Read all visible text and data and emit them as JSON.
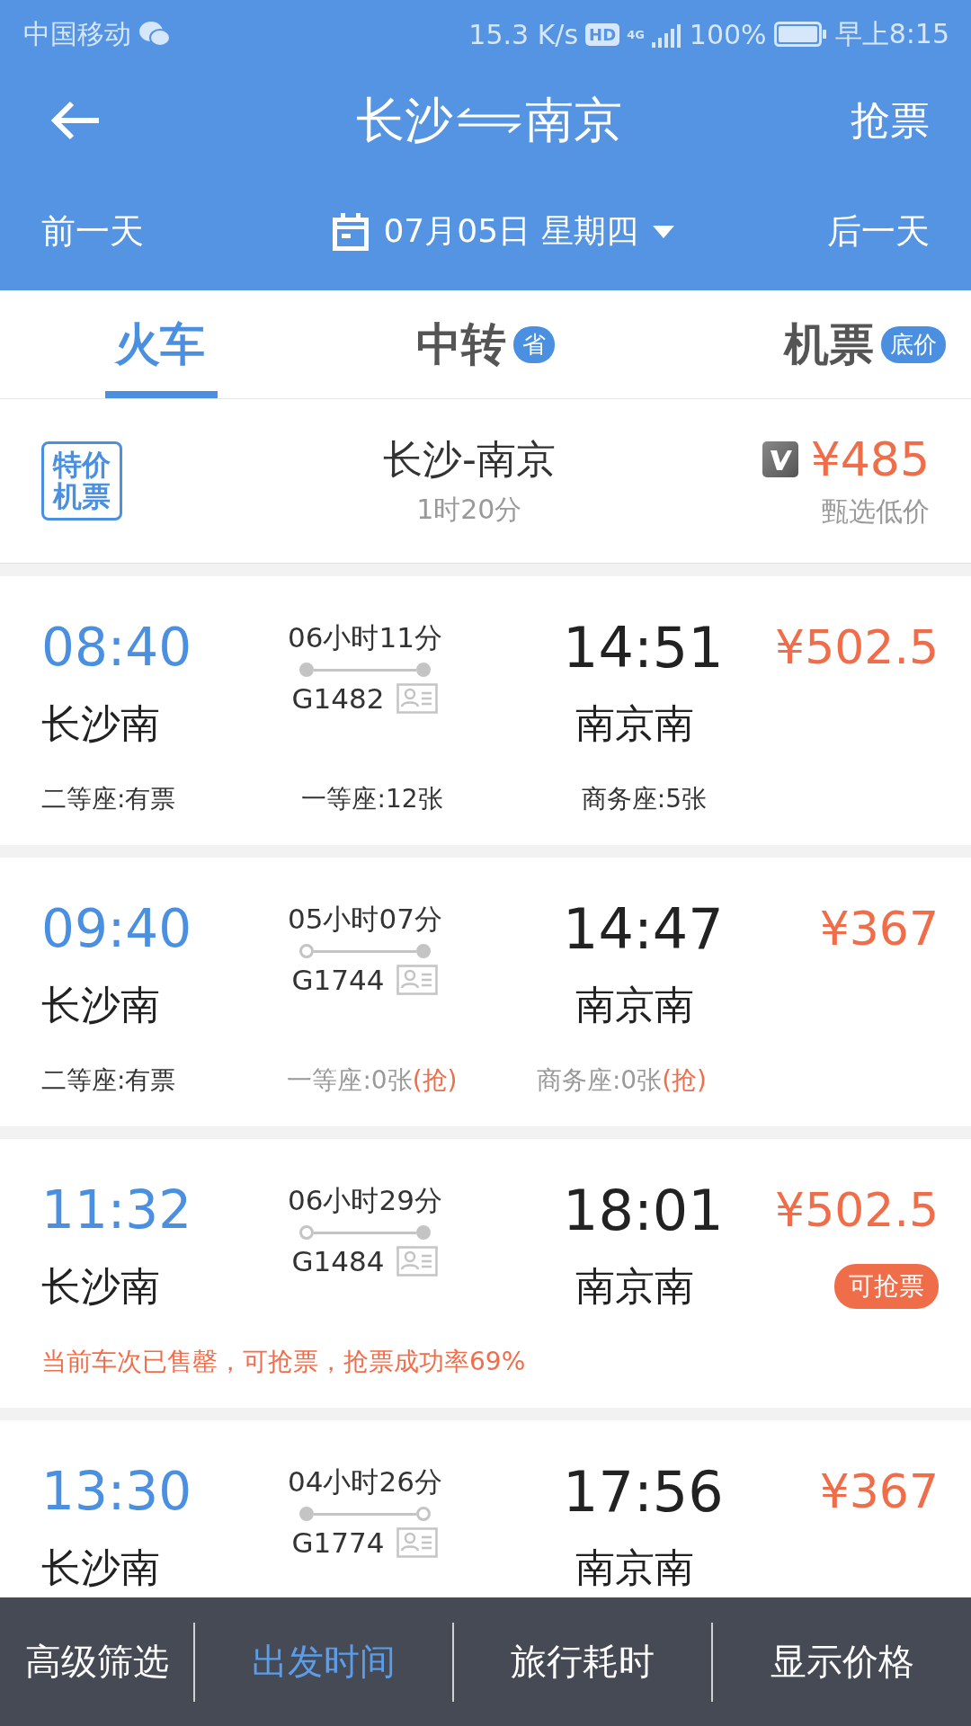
{
  "status_bar": {
    "carrier": "中国移动",
    "speed": "15.3 K/s",
    "hd": "HD",
    "network": "4G",
    "battery": "100%",
    "time": "早上8:15"
  },
  "header": {
    "from": "长沙",
    "to": "南京",
    "action": "抢票",
    "prev_day": "前一天",
    "date": "07月05日 星期四",
    "next_day": "后一天"
  },
  "tabs": [
    {
      "label": "火车",
      "selected": true
    },
    {
      "label": "中转",
      "badge": "省",
      "selected": false
    },
    {
      "label": "机票",
      "badge": "底价",
      "selected": false
    }
  ],
  "flight_promo": {
    "tag": "特价机票",
    "route": "长沙-南京",
    "duration": "1时20分",
    "price": "¥485",
    "price_note": "甄选低价"
  },
  "trains": [
    {
      "depart_time": "08:40",
      "depart_station": "长沙南",
      "duration": "06小时11分",
      "train_no": "G1482",
      "origin": true,
      "terminus": true,
      "arrive_time": "14:51",
      "arrive_station": "南京南",
      "price": "¥502.5",
      "seats": [
        {
          "text": "二等座:有票",
          "sold_out": false
        },
        {
          "text": "一等座:12张",
          "sold_out": false
        },
        {
          "text": "商务座:5张",
          "sold_out": false
        }
      ]
    },
    {
      "depart_time": "09:40",
      "depart_station": "长沙南",
      "duration": "05小时07分",
      "train_no": "G1744",
      "origin": false,
      "terminus": true,
      "arrive_time": "14:47",
      "arrive_station": "南京南",
      "price": "¥367",
      "seats": [
        {
          "text": "二等座:有票",
          "sold_out": false
        },
        {
          "text": "一等座:0张",
          "sold_out": true,
          "grab": "(抢)"
        },
        {
          "text": "商务座:0张",
          "sold_out": true,
          "grab": "(抢)"
        }
      ]
    },
    {
      "depart_time": "11:32",
      "depart_station": "长沙南",
      "duration": "06小时29分",
      "train_no": "G1484",
      "origin": false,
      "terminus": true,
      "arrive_time": "18:01",
      "arrive_station": "南京南",
      "price": "¥502.5",
      "badge": "可抢票",
      "notice": "当前车次已售罄，可抢票，抢票成功率69%"
    },
    {
      "depart_time": "13:30",
      "depart_station": "长沙南",
      "duration": "04小时26分",
      "train_no": "G1774",
      "origin": true,
      "terminus": false,
      "arrive_time": "17:56",
      "arrive_station": "南京南",
      "price": "¥367"
    }
  ],
  "bottom_bar": [
    {
      "label": "高级筛选",
      "selected": false
    },
    {
      "label": "出发时间",
      "selected": true
    },
    {
      "label": "旅行耗时",
      "selected": false
    },
    {
      "label": "显示价格",
      "selected": false
    }
  ]
}
